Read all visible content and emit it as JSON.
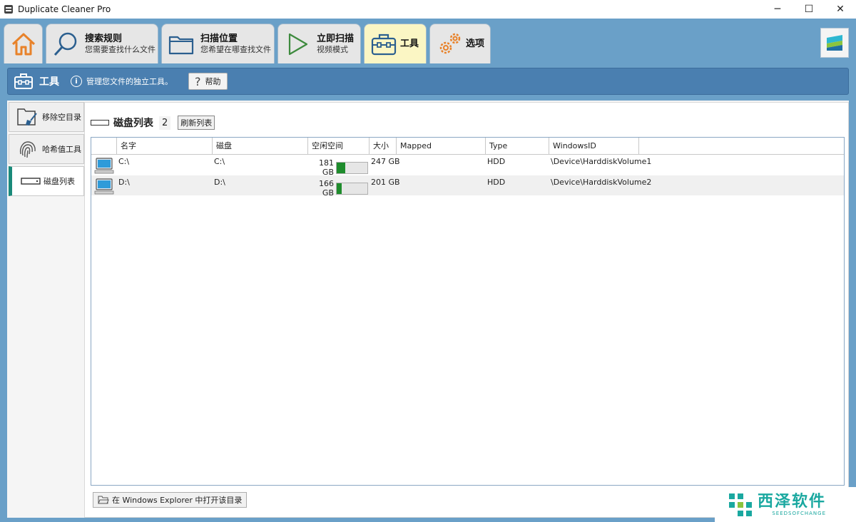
{
  "window": {
    "title": "Duplicate Cleaner Pro",
    "controls": [
      "─",
      "☐",
      "✕"
    ]
  },
  "tabs": [
    {
      "name": "home",
      "icon": "home-icon",
      "title": "",
      "subtitle": ""
    },
    {
      "name": "search-rules",
      "icon": "search-icon",
      "title": "搜索规则",
      "subtitle": "您需要查找什么文件"
    },
    {
      "name": "scan-location",
      "icon": "folder-icon",
      "title": "扫描位置",
      "subtitle": "您希望在哪查找文件"
    },
    {
      "name": "scan-now",
      "icon": "play-icon",
      "title": "立即扫描",
      "subtitle": "视频模式"
    },
    {
      "name": "tools",
      "icon": "toolbox-icon",
      "title": "工具",
      "subtitle": "",
      "active": true
    },
    {
      "name": "options",
      "icon": "gears-icon",
      "title": "选项",
      "subtitle": ""
    }
  ],
  "section": {
    "title": "工具",
    "info_icon": "i",
    "description": "管理您文件的独立工具。",
    "help_label": "帮助",
    "help_glyph": "?"
  },
  "sidebar": {
    "items": [
      {
        "label": "移除空目录",
        "icon": "empty-folder-brush-icon"
      },
      {
        "label": "哈希值工具",
        "icon": "fingerprint-icon"
      },
      {
        "label": "磁盘列表",
        "icon": "drive-icon",
        "active": true
      }
    ]
  },
  "disk_list": {
    "title": "磁盘列表",
    "count": "2",
    "refresh_label": "刷新列表",
    "columns": [
      "名字",
      "磁盘",
      "空闲空间",
      "大小",
      "Mapped",
      "Type",
      "WindowsID"
    ],
    "rows": [
      {
        "name": "C:\\",
        "disk": "C:\\",
        "free": "181 GB",
        "free_fraction": 0.27,
        "size": "247 GB",
        "mapped": "",
        "type": "HDD",
        "windows_id": "\\Device\\HarddiskVolume1"
      },
      {
        "name": "D:\\",
        "disk": "D:\\",
        "free": "166 GB",
        "free_fraction": 0.17,
        "size": "201 GB",
        "mapped": "",
        "type": "HDD",
        "windows_id": "\\Device\\HarddiskVolume2"
      }
    ],
    "open_button_label": "在 Windows Explorer 中打开该目录"
  },
  "watermark": {
    "text": "西泽软件",
    "subtext": "SEEDSOFCHANGE"
  },
  "colors": {
    "ribbon_bg": "#6aa0c8",
    "section_bar": "#4a7fb0",
    "active_tab": "#fbf6c4",
    "sidebar_accent": "#1a8a7a",
    "bar_fill": "#1e8c2c",
    "orange_icon": "#e8822a",
    "blue_icon": "#2b5f8f",
    "watermark": "#1aa8a0"
  }
}
